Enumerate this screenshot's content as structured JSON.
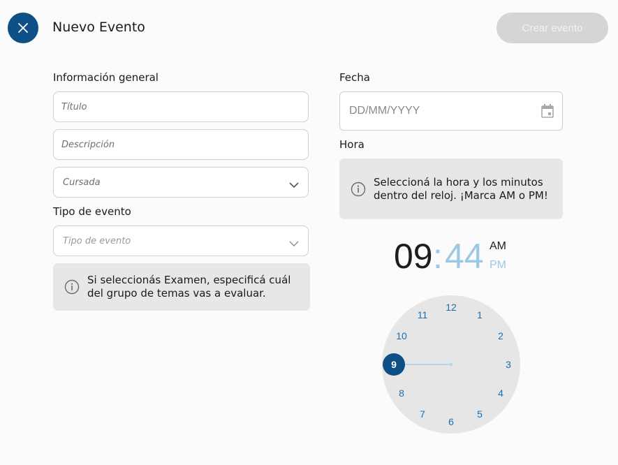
{
  "header": {
    "title": "Nuevo Evento",
    "create_label": "Crear evento",
    "close_icon": "close-icon"
  },
  "general": {
    "section_label": "Información general",
    "title_placeholder": "Título",
    "description_placeholder": "Descripción",
    "course_placeholder": "Cursada"
  },
  "event_type": {
    "section_label": "Tipo de evento",
    "placeholder": "Tipo de evento",
    "info": "Si seleccionás Examen, especificá cuál del grupo de temas vas a evaluar."
  },
  "date": {
    "section_label": "Fecha",
    "placeholder": "DD/MM/YYYY",
    "icon": "calendar-icon"
  },
  "time": {
    "section_label": "Hora",
    "info": "Seleccioná la hora y los minutos dentro del reloj. ¡Marca AM o PM!",
    "hours": "09",
    "separator": ":",
    "minutes": "44",
    "am_label": "AM",
    "pm_label": "PM",
    "selected_period": "AM",
    "selected_hour": 9,
    "clock_numbers": [
      "12",
      "1",
      "2",
      "3",
      "4",
      "5",
      "6",
      "7",
      "8",
      "9",
      "10",
      "11"
    ]
  },
  "colors": {
    "primary": "#0e4f86",
    "accent": "#1a6fb0",
    "muted_blue": "#9cc8e4",
    "disabled": "#d5d5d5"
  }
}
